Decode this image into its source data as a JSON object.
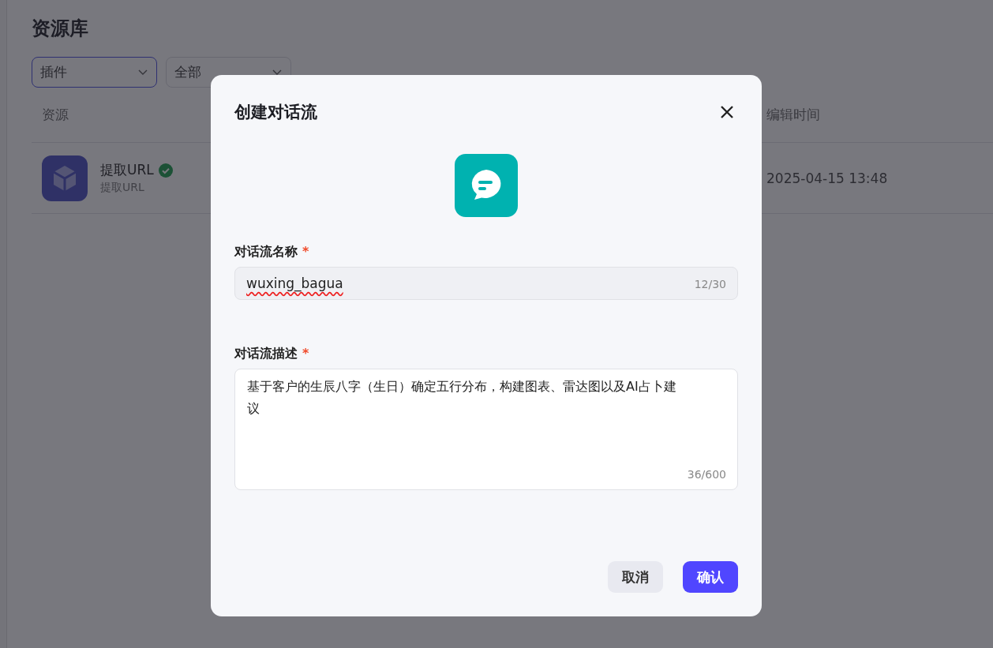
{
  "page": {
    "title": "资源库",
    "filters": [
      {
        "value": "插件",
        "focused": true
      },
      {
        "value": "全部",
        "focused": false
      }
    ],
    "table": {
      "columns": [
        "资源",
        "编辑时间"
      ],
      "rows": [
        {
          "name": "提取URL",
          "verified": true,
          "subtitle": "提取URL",
          "edited": "2025-04-15 13:48"
        }
      ]
    }
  },
  "dialog": {
    "title": "创建对话流",
    "fields": [
      {
        "kind": "input",
        "label": "对话流名称",
        "required_mark": "*",
        "value": "wuxing_bagua",
        "counter": "12/30"
      },
      {
        "kind": "textarea",
        "label": "对话流描述",
        "required_mark": "*",
        "value": "基于客户的生辰八字（生日）确定五行分布，构建图表、雷达图以及AI占卜建议",
        "counter": "36/600"
      }
    ],
    "buttons": [
      {
        "label": "取消",
        "kind": "secondary"
      },
      {
        "label": "确认",
        "kind": "primary"
      }
    ]
  }
}
